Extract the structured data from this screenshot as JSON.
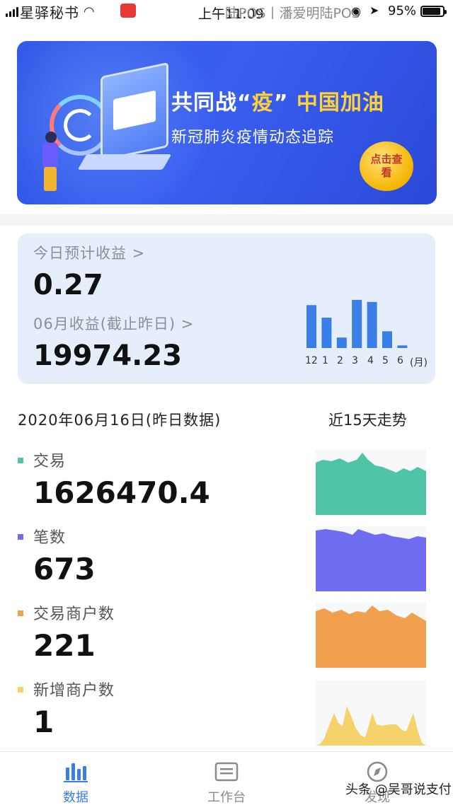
{
  "status_bar": {
    "carrier": "星驿秘书",
    "time": "上午11:09",
    "app_title": "陆POS丨潘爱明陆POS",
    "battery": "95%"
  },
  "banner": {
    "title_part1": "共同战“",
    "title_highlight1": "疫",
    "title_part2": "”",
    "title_highlight2": "中国加油",
    "subtitle": "新冠肺炎疫情动态追踪",
    "button_label": "点击查看"
  },
  "earnings": {
    "today_link": "今日预计收益 >",
    "today_value": "0.27",
    "month_link": "06月收益(截止昨日) >",
    "month_value": "19974.23",
    "months": [
      "12",
      "1",
      "2",
      "3",
      "4",
      "5",
      "6",
      "(月)"
    ],
    "bar_values": [
      0.82,
      0.58,
      0.2,
      0.92,
      0.88,
      0.32,
      0.05
    ],
    "bar_color": "#3a7ee8"
  },
  "stats": {
    "date_heading": "2020年06月16日(昨日数据)",
    "trend_heading": "近15天走势",
    "metrics": [
      {
        "label": "交易",
        "value": "1626470.4",
        "color": "#4fc4a6"
      },
      {
        "label": "笔数",
        "value": "673",
        "color": "#6f6cf2"
      },
      {
        "label": "交易商户数",
        "value": "221",
        "color": "#f0a04e"
      },
      {
        "label": "新增商户数",
        "value": "1",
        "color": "#f6d36a"
      }
    ]
  },
  "tabs": [
    {
      "label": "数据",
      "icon": "bar-chart-icon",
      "active": true
    },
    {
      "label": "工作台",
      "icon": "workbench-icon",
      "active": false
    },
    {
      "label": "发现",
      "icon": "compass-icon",
      "active": false
    }
  ],
  "colors": {
    "tab_active": "#3a7ee8",
    "tab_inactive": "#8a8a8a"
  },
  "watermark": "头条 @吴哥说支付"
}
